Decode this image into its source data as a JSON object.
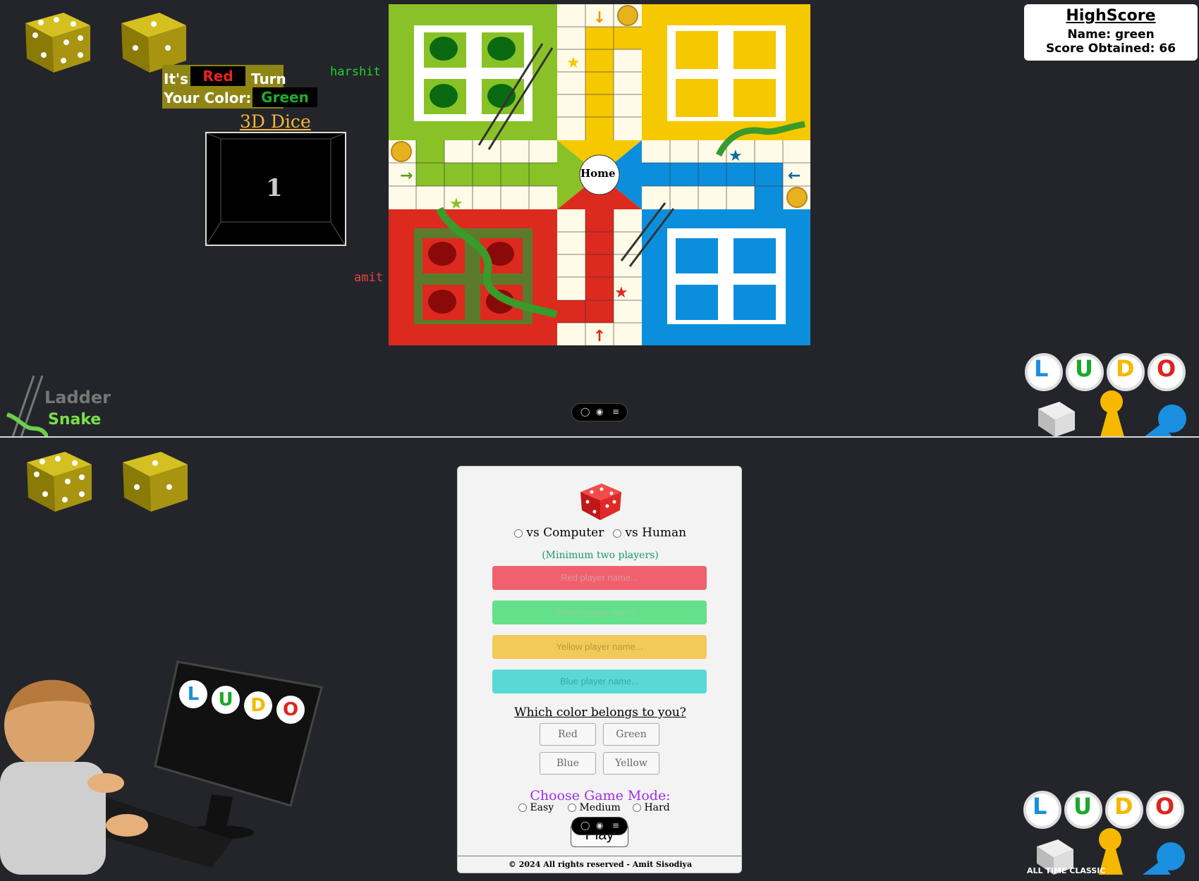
{
  "top": {
    "turn": {
      "prefix": "It's",
      "color": "Red",
      "suffix": "Turn"
    },
    "your_color": {
      "label": "Your Color:",
      "value": "Green"
    },
    "dice3d": {
      "title": "3D Dice",
      "face": "1"
    },
    "players": {
      "green": "harshit",
      "red": "amit"
    },
    "board": {
      "home_label": "Home"
    },
    "highscore": {
      "title": "HighScore",
      "name": "Name: green",
      "score": "Score Obtained: 66"
    },
    "brand": {
      "ladder": "Ladder",
      "snake": "Snake"
    },
    "ludo_letters": [
      "L",
      "U",
      "D",
      "O"
    ]
  },
  "bottom": {
    "modes": {
      "vs_computer": "vs Computer",
      "vs_human": "vs Human"
    },
    "min_players_note": "(Minimum two players)",
    "inputs": {
      "red": "Red player name...",
      "green": "Green player name...",
      "yellow": "Yellow player name...",
      "blue": "Blue player name..."
    },
    "color_question": "Which color belongs to you?",
    "color_options": [
      "Red",
      "Green",
      "Blue",
      "Yellow"
    ],
    "game_mode": {
      "title": "Choose Game Mode:",
      "easy": "Easy",
      "medium": "Medium",
      "hard": "Hard"
    },
    "play_label": "Play",
    "footer": "© 2024 All rights reserved - Amit Sisodiya",
    "ludo_letters": [
      "L",
      "U",
      "D",
      "O"
    ],
    "tagline": "ALL TIME CLASSIC",
    "monitor_letters": [
      "L",
      "U",
      "D",
      "O"
    ]
  },
  "colors": {
    "red": "#dc2a1f",
    "green": "#89c226",
    "yellow": "#f6c800",
    "blue": "#0b8fdc",
    "bg": "#23252b"
  }
}
